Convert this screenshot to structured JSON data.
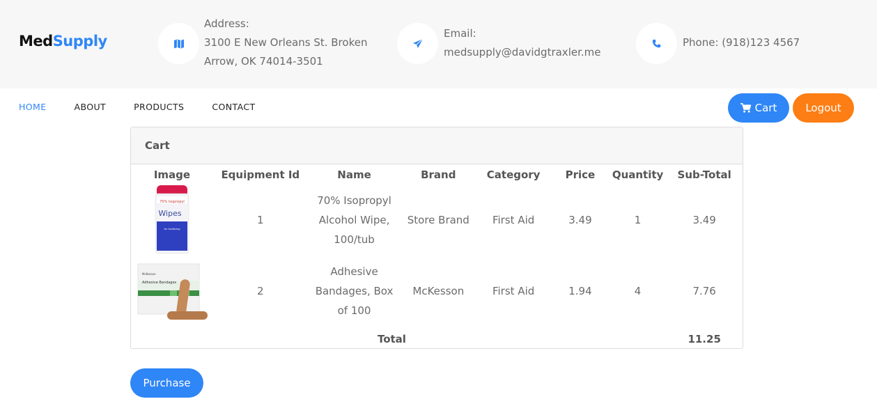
{
  "brand": {
    "part1": "Med",
    "part2": "Supply"
  },
  "contact": {
    "address_label": "Address:",
    "address_line1": "3100 E New Orleans St. Broken",
    "address_line2": "Arrow, OK 74014-3501",
    "email_label": "Email:",
    "email_value": "medsupply@davidgtraxler.me",
    "phone": "Phone: (918)123 4567",
    "icons": [
      "map-icon",
      "paper-plane-icon",
      "phone-icon"
    ]
  },
  "nav": {
    "items": [
      "HOME",
      "ABOUT",
      "PRODUCTS",
      "CONTACT"
    ],
    "active": "HOME"
  },
  "header_buttons": {
    "cart": "Cart",
    "logout": "Logout"
  },
  "cart": {
    "title": "Cart",
    "columns": [
      "Image",
      "Equipment Id",
      "Name",
      "Brand",
      "Category",
      "Price",
      "Quantity",
      "Sub-Total"
    ],
    "rows": [
      {
        "id": "1",
        "name": "70% Isopropyl Alcohol Wipe, 100/tub",
        "brand": "Store Brand",
        "category": "First Aid",
        "price": "3.49",
        "quantity": "1",
        "subtotal": "3.49",
        "image": "alcohol-wipes-tub"
      },
      {
        "id": "2",
        "name": "Adhesive Bandages, Box of 100",
        "brand": "McKesson",
        "category": "First Aid",
        "price": "1.94",
        "quantity": "4",
        "subtotal": "7.76",
        "image": "adhesive-bandages-box"
      }
    ],
    "total_label": "Total",
    "total_value": "11.25"
  },
  "purchase_button": "Purchase",
  "colors": {
    "accent": "#2f86f6",
    "logout": "#fd7e14",
    "header_bg": "#f7f7f7"
  }
}
